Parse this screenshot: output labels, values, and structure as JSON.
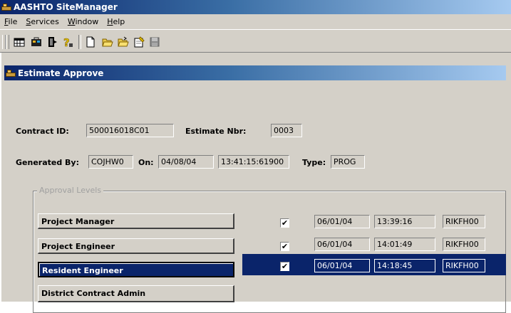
{
  "app": {
    "title": "AASHTO SiteManager"
  },
  "menu": [
    {
      "label": "File",
      "key": "F",
      "rest": "ile"
    },
    {
      "label": "Services",
      "key": "S",
      "rest": "ervices"
    },
    {
      "label": "Window",
      "key": "W",
      "rest": "indow"
    },
    {
      "label": "Help",
      "key": "H",
      "rest": "elp"
    }
  ],
  "toolbar": [
    "grid-icon",
    "briefcase-icon",
    "exit-door-icon",
    "help-question-icon",
    "new-document-icon",
    "open-folder-icon",
    "open-folder-alt-icon",
    "notepad-icon",
    "save-disk-icon"
  ],
  "window": {
    "title": "Estimate Approve"
  },
  "form": {
    "contract_id_label": "Contract ID:",
    "contract_id": "500016018C01",
    "estimate_nbr_label": "Estimate Nbr:",
    "estimate_nbr": "0003",
    "generated_by_label": "Generated By:",
    "generated_by": "COJHW0",
    "on_label": "On:",
    "on_date": "04/08/04",
    "on_time": "13:41:15:61900",
    "type_label": "Type:",
    "type": "PROG"
  },
  "approval": {
    "group_title": "Approval Levels",
    "levels": [
      {
        "label": "Project Manager",
        "checked": true,
        "date": "06/01/04",
        "time": "13:39:16",
        "user": "RIKFH00",
        "selected": false
      },
      {
        "label": "Project Engineer",
        "checked": true,
        "date": "06/01/04",
        "time": "14:01:49",
        "user": "RIKFH00",
        "selected": false
      },
      {
        "label": "Resident Engineer",
        "checked": true,
        "date": "06/01/04",
        "time": "14:18:45",
        "user": "RIKFH00",
        "selected": true
      },
      {
        "label": "District Contract Admin",
        "checked": false,
        "date": "",
        "time": "",
        "user": "",
        "selected": false
      }
    ],
    "check_glyph": "✔"
  }
}
